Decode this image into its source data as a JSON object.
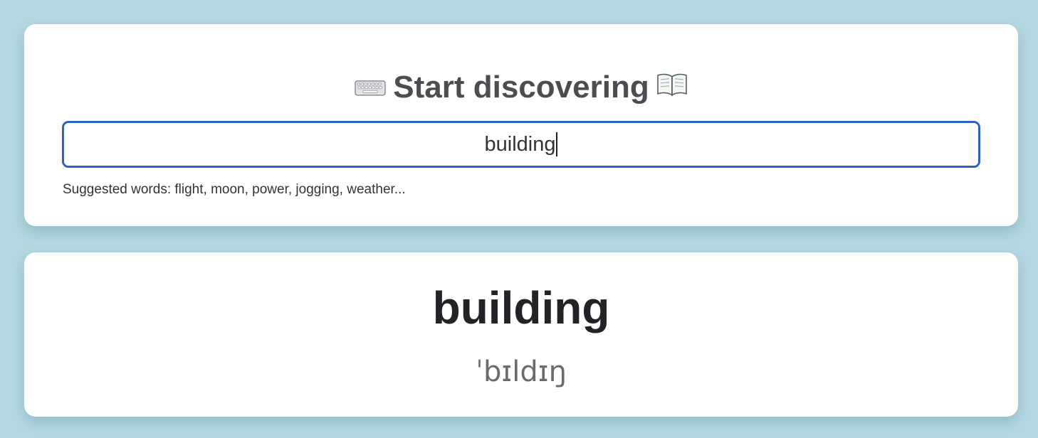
{
  "search": {
    "title": "Start discovering",
    "title_left_icon": "keyboard-icon",
    "title_right_icon": "open-book-icon",
    "input_value": "building",
    "suggestions_text": "Suggested words: flight, moon, power, jogging, weather..."
  },
  "result": {
    "word": "building",
    "phonetic": "ˈbɪldɪŋ"
  },
  "colors": {
    "page_background": "#b4d8e3",
    "card_background": "#ffffff",
    "input_border": "#2e62c2",
    "heading_text": "#212327",
    "title_text": "#4b4d51",
    "phonetic_text": "#6a6b6d"
  }
}
